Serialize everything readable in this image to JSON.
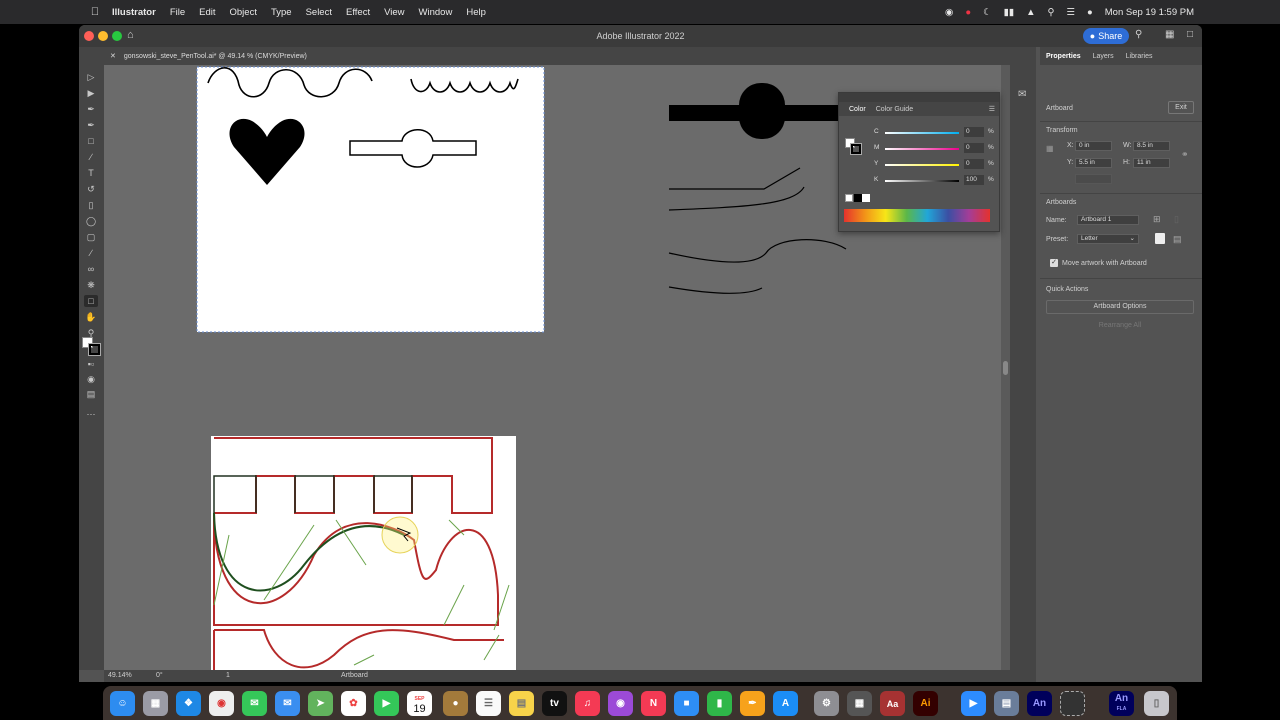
{
  "menubar": {
    "app_name": "Illustrator",
    "menus": [
      "File",
      "Edit",
      "Object",
      "Type",
      "Select",
      "Effect",
      "View",
      "Window",
      "Help"
    ],
    "clock": "Mon Sep 19  1:59 PM"
  },
  "window": {
    "title": "Adobe Illustrator 2022",
    "share_label": "Share",
    "doc_tab": "gonsowski_steve_PenTool.ai* @ 49.14 % (CMYK/Preview)"
  },
  "statusbar": {
    "zoom": "49.14%",
    "rotation": "0°",
    "artboard_num": "1",
    "tool_label": "Artboard"
  },
  "color_panel": {
    "tabs": [
      "Color",
      "Color Guide"
    ],
    "sliders": [
      {
        "label": "C",
        "value": "0",
        "pct": "%",
        "color": "#00aeef"
      },
      {
        "label": "M",
        "value": "0",
        "pct": "%",
        "color": "#ec008c"
      },
      {
        "label": "Y",
        "value": "0",
        "pct": "%",
        "color": "#fff200"
      },
      {
        "label": "K",
        "value": "100",
        "pct": "%",
        "color": "#000000"
      }
    ]
  },
  "properties": {
    "tabs": [
      "Properties",
      "Layers",
      "Libraries"
    ],
    "section_artboard": "Artboard",
    "exit_label": "Exit",
    "transform_label": "Transform",
    "x_label": "X:",
    "x_value": "0 in",
    "y_label": "Y:",
    "y_value": "5.5 in",
    "w_label": "W:",
    "w_value": "8.5 in",
    "h_label": "H:",
    "h_value": "11 in",
    "artboards_label": "Artboards",
    "name_label": "Name:",
    "name_value": "Artboard 1",
    "preset_label": "Preset:",
    "preset_value": "Letter",
    "move_artwork_label": "Move artwork with Artboard",
    "quick_actions_label": "Quick Actions",
    "artboard_options_label": "Artboard Options",
    "rearrange_label": "Rearrange All"
  },
  "dock": {
    "cal_month": "SEP",
    "cal_day": "19",
    "app_tv": "tv",
    "app_aa": "Aa",
    "app_ai": "Ai",
    "app_an": "An",
    "app_an_fla": "An",
    "fla_label": "FLA"
  }
}
